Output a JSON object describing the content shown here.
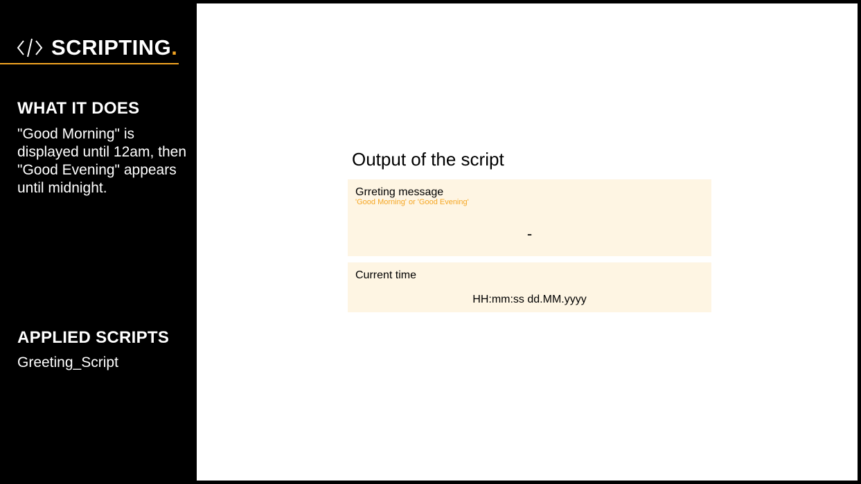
{
  "colors": {
    "background": "#000000",
    "accent": "#f5a623",
    "card": "#fef5e3",
    "panel": "#ffffff"
  },
  "sidebar": {
    "brand": {
      "icon": "code-brackets-icon",
      "title": "SCRIPTING",
      "dot": "."
    },
    "what_it_does": {
      "heading": "WHAT IT DOES",
      "body": "\"Good Morning\" is displayed until 12am, then \"Good Evening\" appears until midnight."
    },
    "applied_scripts": {
      "heading": "APPLIED SCRIPTS",
      "items": [
        "Greeting_Script"
      ]
    }
  },
  "main": {
    "title": "Output of the script",
    "greeting_card": {
      "label": "Grreting message",
      "sublabel": "'Good Morning' or 'Good Evening'",
      "value": "-"
    },
    "time_card": {
      "label": "Current time",
      "value": "HH:mm:ss dd.MM.yyyy"
    }
  }
}
